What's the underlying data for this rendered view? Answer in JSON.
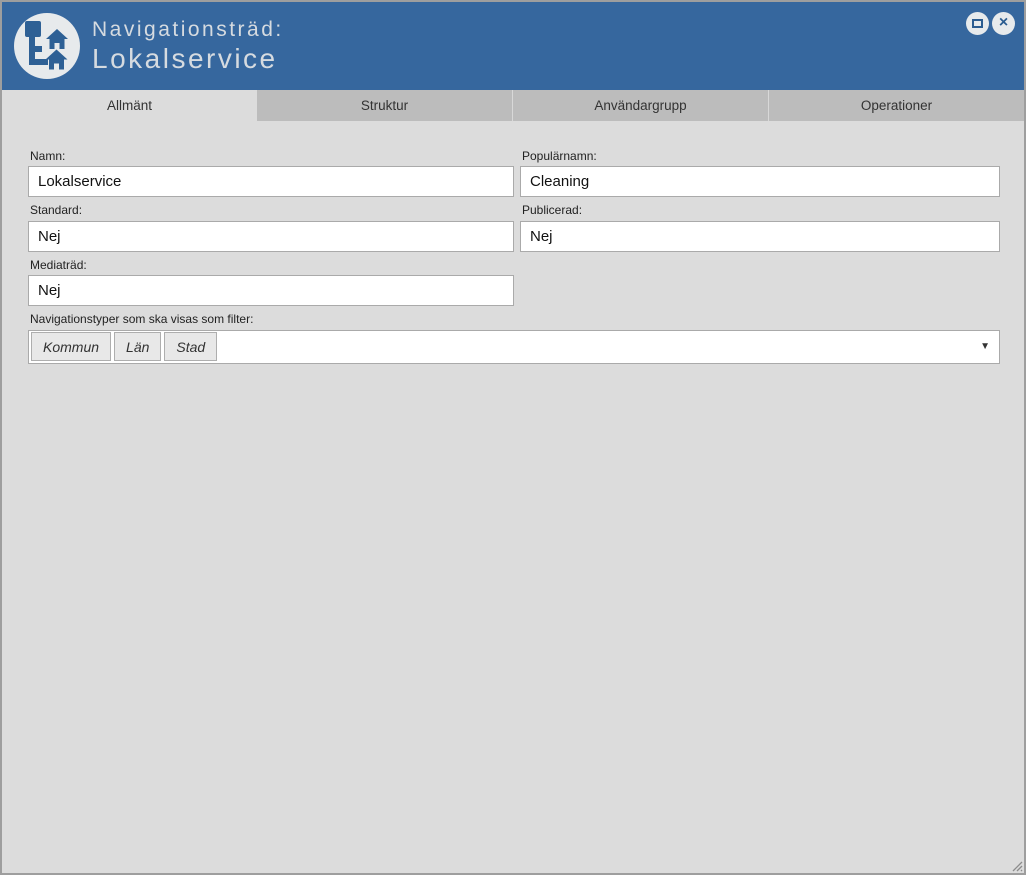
{
  "window": {
    "title_line1": "Navigationsträd:",
    "title_line2": "Lokalservice",
    "close_glyph": "×",
    "header_color": "#36679e",
    "title_text_color": "#d6dbe0"
  },
  "tabs": [
    {
      "label": "Allmänt",
      "active": true
    },
    {
      "label": "Struktur",
      "active": false
    },
    {
      "label": "Användargrupp",
      "active": false
    },
    {
      "label": "Operationer",
      "active": false
    }
  ],
  "form": {
    "fields": [
      {
        "label": "Namn:",
        "value": "Lokalservice"
      },
      {
        "label": "Populärnamn:",
        "value": "Cleaning"
      },
      {
        "label": "Standard:",
        "value": "Nej"
      },
      {
        "label": "Publicerad:",
        "value": "Nej"
      },
      {
        "label": "Mediaträd:",
        "value": "Nej"
      }
    ],
    "filter": {
      "label": "Navigationstyper som ska visas som filter:",
      "chips": [
        "Kommun",
        "Län",
        "Stad"
      ],
      "dropdown_glyph": "▼"
    }
  },
  "colors": {
    "content_bg": "#dcdcdc",
    "inactive_tab_bg": "#bcbcbc",
    "input_border": "#aaaaaa",
    "icon_blue": "#2e6095",
    "window_border": "#9e9e9e"
  }
}
